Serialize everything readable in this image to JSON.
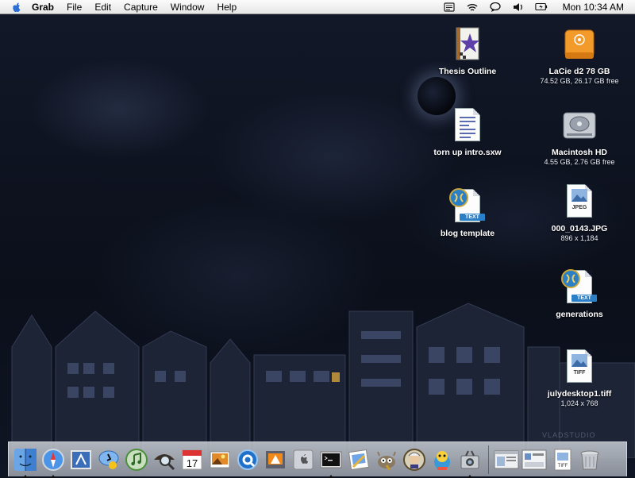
{
  "menubar": {
    "app_name": "Grab",
    "items": [
      "File",
      "Edit",
      "Capture",
      "Window",
      "Help"
    ],
    "clock": "Mon 10:34 AM",
    "status_icons": [
      "script-icon",
      "wifi-icon",
      "ichat-icon",
      "volume-icon",
      "battery-icon"
    ]
  },
  "desktop": {
    "icons": [
      {
        "label": "Thesis Outline",
        "icon": "star-document-icon"
      },
      {
        "label": "torn up intro.sxw",
        "icon": "text-document-icon"
      },
      {
        "label": "blog template",
        "icon": "text-file-icon",
        "badge": "TEXT"
      },
      {
        "label": "LaCie d2 78 GB",
        "sub": "74.52 GB, 26.17 GB free",
        "icon": "external-drive-icon"
      },
      {
        "label": "Macintosh HD",
        "sub": "4.55 GB, 2.76 GB free",
        "icon": "hard-drive-icon"
      },
      {
        "label": "000_0143.JPG",
        "sub": "896 x 1,184",
        "icon": "jpeg-file-icon",
        "badge": "JPEG"
      },
      {
        "label": "generations",
        "icon": "text-file-icon",
        "badge": "TEXT"
      },
      {
        "label": "julydesktop1.tiff",
        "sub": "1,024 x 768",
        "icon": "tiff-file-icon",
        "badge": "TIFF"
      }
    ]
  },
  "watermark": "VLADSTUDIO",
  "dock": {
    "apps": [
      {
        "name": "Finder",
        "icon": "finder-icon",
        "running": true
      },
      {
        "name": "Safari",
        "icon": "safari-icon",
        "running": true
      },
      {
        "name": "Mail",
        "icon": "mail-icon",
        "running": false
      },
      {
        "name": "iChat",
        "icon": "ichat-icon",
        "running": false
      },
      {
        "name": "iTunes",
        "icon": "itunes-icon",
        "running": false
      },
      {
        "name": "Sherlock",
        "icon": "sherlock-icon",
        "running": false
      },
      {
        "name": "iCal",
        "icon": "ical-icon",
        "running": false,
        "text": "17"
      },
      {
        "name": "iPhoto",
        "icon": "iphoto-icon",
        "running": false
      },
      {
        "name": "QuickTime Player",
        "icon": "quicktime-icon",
        "running": false
      },
      {
        "name": "VLC",
        "icon": "vlc-icon",
        "running": false
      },
      {
        "name": "System Preferences",
        "icon": "system-preferences-icon",
        "running": false
      },
      {
        "name": "Terminal",
        "icon": "terminal-icon",
        "running": true
      },
      {
        "name": "Preview",
        "icon": "preview-icon",
        "running": false
      },
      {
        "name": "GIMP",
        "icon": "gimp-icon",
        "running": false
      },
      {
        "name": "Mozart",
        "icon": "mozart-icon",
        "running": false
      },
      {
        "name": "Adium",
        "icon": "adium-icon",
        "running": false
      },
      {
        "name": "Grab",
        "icon": "grab-icon",
        "running": true
      }
    ],
    "docs": [
      {
        "name": "Window 1",
        "icon": "window-thumbnail-icon"
      },
      {
        "name": "Window 2",
        "icon": "window-thumbnail-icon"
      },
      {
        "name": "TIFF document",
        "icon": "tiff-file-icon"
      },
      {
        "name": "Trash",
        "icon": "trash-icon"
      }
    ]
  }
}
